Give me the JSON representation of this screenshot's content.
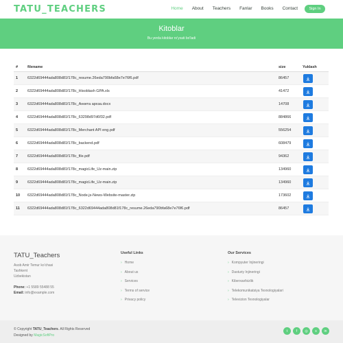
{
  "header": {
    "logo": "TATU_TEACHERS",
    "nav": [
      "Home",
      "About",
      "Teachers",
      "Fanlar",
      "Books",
      "Contact"
    ],
    "active_nav": "Home",
    "signin": "Sign In"
  },
  "hero": {
    "title": "Kitoblar",
    "subtitle": "Bu yerda kitoblar ro'yxati bo'ladi"
  },
  "table": {
    "headers": [
      "#",
      "filename",
      "size",
      "Yuklash"
    ],
    "rows": [
      {
        "n": "1",
        "filename": "6322d69444ada808d81f178c_resume.26eda790bfa68e7e76f6.pdf",
        "size": "86457"
      },
      {
        "n": "2",
        "filename": "6322d69444ada808d81f178c_Hisoblash GPA.xls",
        "size": "41472"
      },
      {
        "n": "3",
        "filename": "6322d69444ada808d81f178c_Анкета архза.docx",
        "size": "14708"
      },
      {
        "n": "4",
        "filename": "6322d69444ada808d81f178c_63298d97d6f32.pdf",
        "size": "884866"
      },
      {
        "n": "5",
        "filename": "6322d69444ada808d81f178c_Merchant API eng.pdf",
        "size": "556254"
      },
      {
        "n": "6",
        "filename": "6322d69444ada808d81f178c_backend.pdf",
        "size": "608479"
      },
      {
        "n": "7",
        "filename": "6322d69444ada808d81f178c_file.pdf",
        "size": "94362"
      },
      {
        "n": "8",
        "filename": "6322d69444ada808d81f178c_magicLife_Uz-main.zip",
        "size": "134960"
      },
      {
        "n": "9",
        "filename": "6322d69444ada808d81f178c_magicLife_Uz-main.zip",
        "size": "134960"
      },
      {
        "n": "10",
        "filename": "6322d69444ada808d81f178c_Node.js-News-Website-master.zip",
        "size": "173602"
      },
      {
        "n": "11",
        "filename": "6322d69444ada808d81f178c_6322d69444ada808d81f178c_resume.26eda790bfa68e7e76f6.pdf",
        "size": "86457"
      }
    ]
  },
  "footer": {
    "brand": "TATU_Teachers",
    "address_lines": [
      "Asob Amir Temur ko'chasi",
      "Tashkent",
      "Uzbekistan"
    ],
    "phone_label": "Phone:",
    "phone": "+1 5589 55488 55",
    "email_label": "Email:",
    "email": "info@example.com",
    "useful_title": "Useful Links",
    "useful_links": [
      "Home",
      "About us",
      "Services",
      "Terms of service",
      "Privacy policy"
    ],
    "services_title": "Our Services",
    "services": [
      "Kompyuter Injineringi",
      "Dasturiy Injineringi",
      "Kiberxavfsizlik",
      "Telekomunikatsiya Texnologiyalari",
      "Televizion Texnologiyalar"
    ]
  },
  "bottom": {
    "copy_prefix": "© Copyright ",
    "copy_brand": "TATU_Teachers",
    "copy_suffix": ". All Rights Reserved",
    "designed_by_prefix": "Designed by ",
    "designed_by": "MagicSoftPro",
    "social": [
      {
        "icon": "twitter-icon",
        "glyph": "t"
      },
      {
        "icon": "facebook-icon",
        "glyph": "f"
      },
      {
        "icon": "instagram-icon",
        "glyph": "◎"
      },
      {
        "icon": "skype-icon",
        "glyph": "s"
      },
      {
        "icon": "linkedin-icon",
        "glyph": "in"
      }
    ]
  },
  "colors": {
    "accent": "#5fcf80",
    "button": "#1e7be0"
  }
}
